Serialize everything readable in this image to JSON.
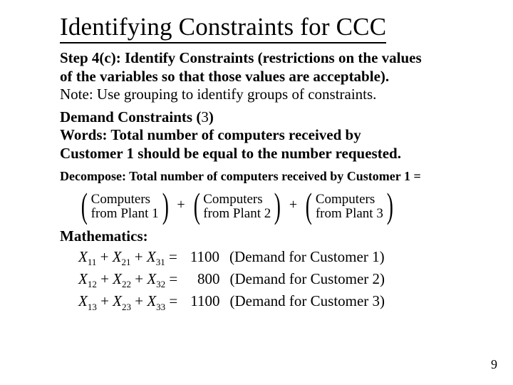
{
  "title": "Identifying Constraints for CCC",
  "intro": {
    "line1a": "Step 4(c): Identify Constraints (restrictions on the values",
    "line1b": "of the variables so that those values are acceptable).",
    "line2": "Note: Use grouping to identify groups of constraints."
  },
  "demand": {
    "heading_a": "Demand Constraints (",
    "count": "3",
    "heading_b": ")",
    "words1": "Words: Total number of computers received by",
    "words2": "Customer 1 should be equal to the number requested."
  },
  "decompose": "Decompose: Total number of computers received by Customer 1 =",
  "terms": [
    {
      "l1": "Computers",
      "l2": "from Plant 1"
    },
    {
      "l1": "Computers",
      "l2": "from Plant 2"
    },
    {
      "l1": "Computers",
      "l2": "from Plant 3"
    }
  ],
  "mathlabel": "Mathematics:",
  "equations": [
    {
      "x1": "11",
      "x2": "21",
      "x3": "31",
      "rhs": "1100",
      "lbl": "(Demand for Customer 1)"
    },
    {
      "x1": "12",
      "x2": "22",
      "x3": "32",
      "rhs": "800",
      "lbl": "(Demand for Customer 2)"
    },
    {
      "x1": "13",
      "x2": "23",
      "x3": "33",
      "rhs": "1100",
      "lbl": "(Demand for Customer 3)"
    }
  ],
  "pagenum": "9"
}
